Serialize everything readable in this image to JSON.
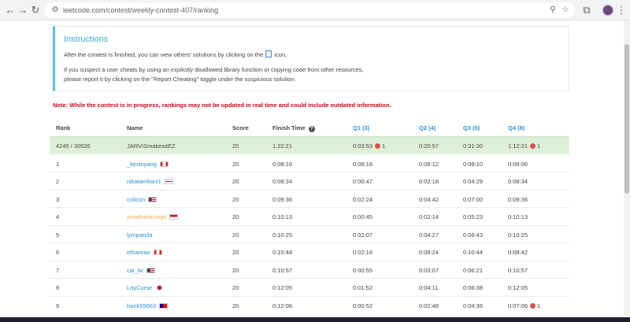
{
  "browser": {
    "url": "leetcode.com/contest/weekly-contest-407/ranking"
  },
  "instructions": {
    "title": "Instructions",
    "line1a": "After the contest is finished, you can view others' solutions by clicking on the ",
    "line1b": " icon.",
    "line2a": "If you suspect a user cheats by using an ",
    "line2em": "explicitly",
    "line2b": " disallowed library function or copying code from other resources,",
    "line3": "please report it by clicking on the \"Report Cheating\" toggle under the suspicious solution."
  },
  "warning": "Note: While the contest is in progress, rankings may not be updated in real time and could include outdated information.",
  "table": {
    "headers": {
      "rank": "Rank",
      "name": "Name",
      "score": "Score",
      "finish": "Finish Time",
      "q1": "Q1 (3)",
      "q2": "Q2 (4)",
      "q3": "Q3 (5)",
      "q4": "Q4 (8)"
    },
    "rows": [
      {
        "rank": "4245 / 30526",
        "name": "JARVISmakesitEZ",
        "score": "20",
        "finish": "1:22:21",
        "q1": "0:03:53",
        "q1_bugs": "1",
        "q2": "0:20:57",
        "q3": "0:31:30",
        "q4": "1:12:21",
        "q4_bugs": "1"
      },
      {
        "rank": "1",
        "name": "_kevinyang",
        "score": "20",
        "finish": "0:08:16",
        "q1": "0:08:16",
        "q2": "0:08:12",
        "q3": "0:08:10",
        "q4": "0:08:06"
      },
      {
        "rank": "2",
        "name": "nikatamliani1",
        "score": "20",
        "finish": "0:08:34",
        "q1": "0:00:47",
        "q2": "0:02:18",
        "q3": "0:04:29",
        "q4": "0:08:34"
      },
      {
        "rank": "3",
        "name": "colicon",
        "score": "20",
        "finish": "0:09:36",
        "q1": "0:02:24",
        "q2": "0:04:42",
        "q3": "0:07:00",
        "q4": "0:09:36"
      },
      {
        "rank": "4",
        "name": "jonathanirvings",
        "score": "20",
        "finish": "0:10:13",
        "q1": "0:00:45",
        "q2": "0:02:14",
        "q3": "0:05:23",
        "q4": "0:10:13"
      },
      {
        "rank": "5",
        "name": "lympanda",
        "score": "20",
        "finish": "0:10:25",
        "q1": "0:02:07",
        "q2": "0:04:27",
        "q3": "0:06:43",
        "q4": "0:10:25"
      },
      {
        "rank": "6",
        "name": "ethanrao",
        "score": "20",
        "finish": "0:10:44",
        "q1": "0:02:16",
        "q2": "0:08:24",
        "q3": "0:10:44",
        "q4": "0:08:42"
      },
      {
        "rank": "7",
        "name": "cai_lw",
        "score": "20",
        "finish": "0:10:57",
        "q1": "0:00:55",
        "q2": "0:03:07",
        "q3": "0:06:21",
        "q4": "0:10:57"
      },
      {
        "rank": "8",
        "name": "LayCurse",
        "score": "20",
        "finish": "0:12:05",
        "q1": "0:01:52",
        "q2": "0:04:11",
        "q3": "0:06:38",
        "q4": "0:12:05"
      },
      {
        "rank": "9",
        "name": "hank55663",
        "score": "20",
        "finish": "0:12:06",
        "q1": "0:00:52",
        "q2": "0:02:48",
        "q3": "0:04:36",
        "q4": "0:07:06",
        "q4_bugs": "1"
      }
    ]
  },
  "colors": {
    "accent_link": "#2d8ed6",
    "warning_red": "#d0021b",
    "self_row_bg": "#dff0d8",
    "info_border": "#5bc0de"
  }
}
